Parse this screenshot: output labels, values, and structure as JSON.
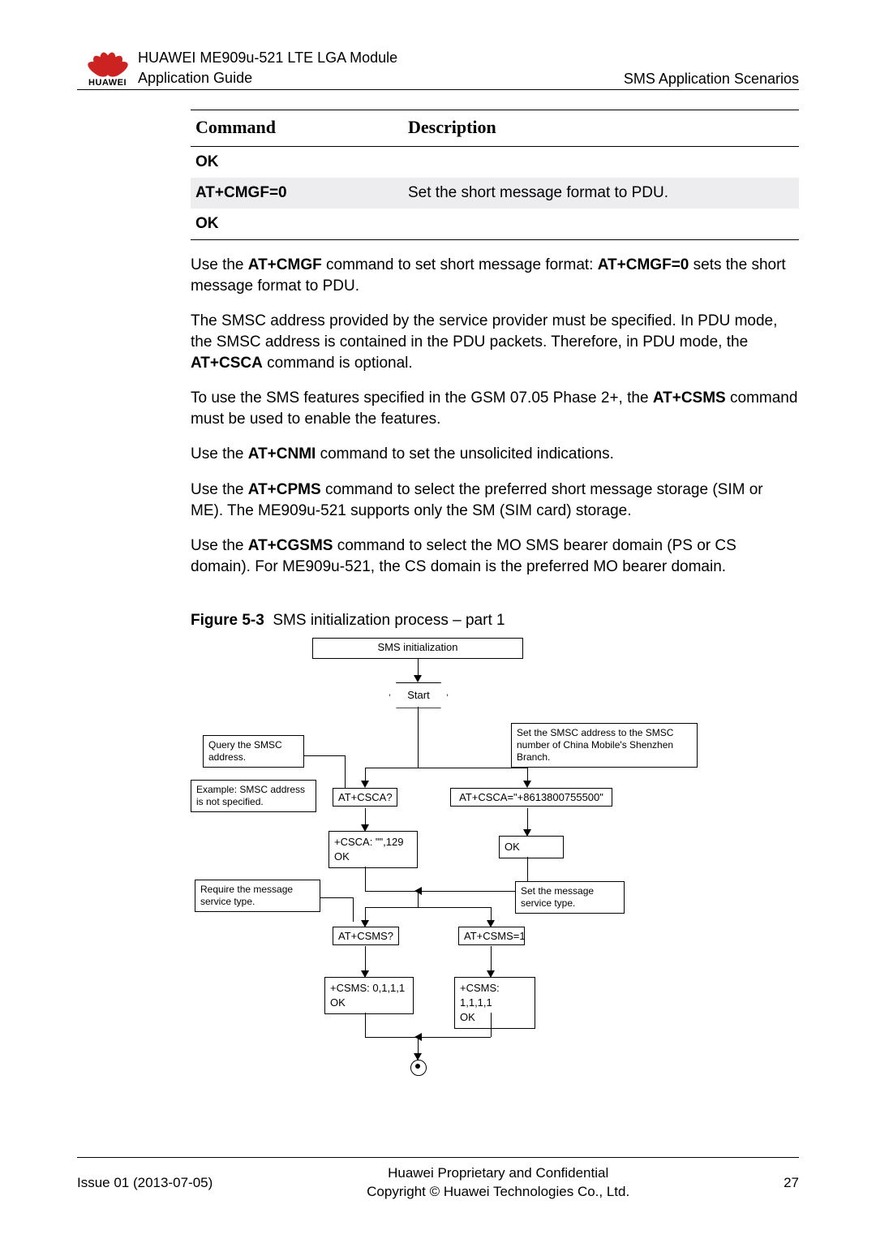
{
  "header": {
    "product": "HUAWEI ME909u-521 LTE LGA Module",
    "doc": "Application Guide",
    "section": "SMS Application Scenarios",
    "brand": "HUAWEI"
  },
  "table": {
    "head_cmd": "Command",
    "head_desc": "Description",
    "rows": [
      {
        "cmd": "OK",
        "desc": ""
      },
      {
        "cmd": "AT+CMGF=0",
        "desc": "Set the short message format to PDU."
      },
      {
        "cmd": "OK",
        "desc": ""
      }
    ]
  },
  "para": {
    "p1a": "Use the ",
    "p1b": "AT+CMGF",
    "p1c": " command to set short message format: ",
    "p1d": "AT+CMGF=0",
    "p1e": " sets the short message format to PDU.",
    "p2a": "The SMSC address provided by the service provider must be specified. In PDU mode, the SMSC address is contained in the PDU packets. Therefore, in PDU mode, the ",
    "p2b": "AT+CSCA",
    "p2c": " command is optional.",
    "p3a": "To use the SMS features specified in the GSM 07.05 Phase 2+, the ",
    "p3b": "AT+CSMS",
    "p3c": " command must be used to enable the features.",
    "p4a": "Use the ",
    "p4b": "AT+CNMI",
    "p4c": " command to set the unsolicited indications.",
    "p5a": "Use the ",
    "p5b": "AT+CPMS",
    "p5c": " command to select the preferred short message storage (SIM or ME). The ME909u-521 supports only the SM (SIM card) storage.",
    "p6a": "Use the ",
    "p6b": "AT+CGSMS",
    "p6c": " command to select the MO SMS bearer domain (PS or CS domain). For ME909u-521, the CS domain is the preferred MO bearer domain."
  },
  "figure": {
    "label": "Figure 5-3",
    "caption": "SMS initialization process – part 1",
    "title_box": "SMS initialization",
    "start": "Start",
    "note_query": "Query the SMSC address.",
    "note_example": "Example: SMSC address is not specified.",
    "note_set_smsc": "Set the SMSC address to the SMSC number of China Mobile's Shenzhen Branch.",
    "note_require": "Require the message service type.",
    "note_set_type": "Set the message service type.",
    "cmd_csca_q": "AT+CSCA?",
    "cmd_csca_set": "AT+CSCA=\"+8613800755500\"",
    "resp_csca": "+CSCA: \"\",129\nOK",
    "resp_ok": "OK",
    "cmd_csms_q": "AT+CSMS?",
    "cmd_csms_set": "AT+CSMS=1",
    "resp_csms0": "+CSMS: 0,1,1,1\nOK",
    "resp_csms1": "+CSMS: 1,1,1,1\nOK"
  },
  "footer": {
    "issue": "Issue 01 (2013-07-05)",
    "line1": "Huawei Proprietary and Confidential",
    "line2": "Copyright © Huawei Technologies Co., Ltd.",
    "page": "27"
  }
}
